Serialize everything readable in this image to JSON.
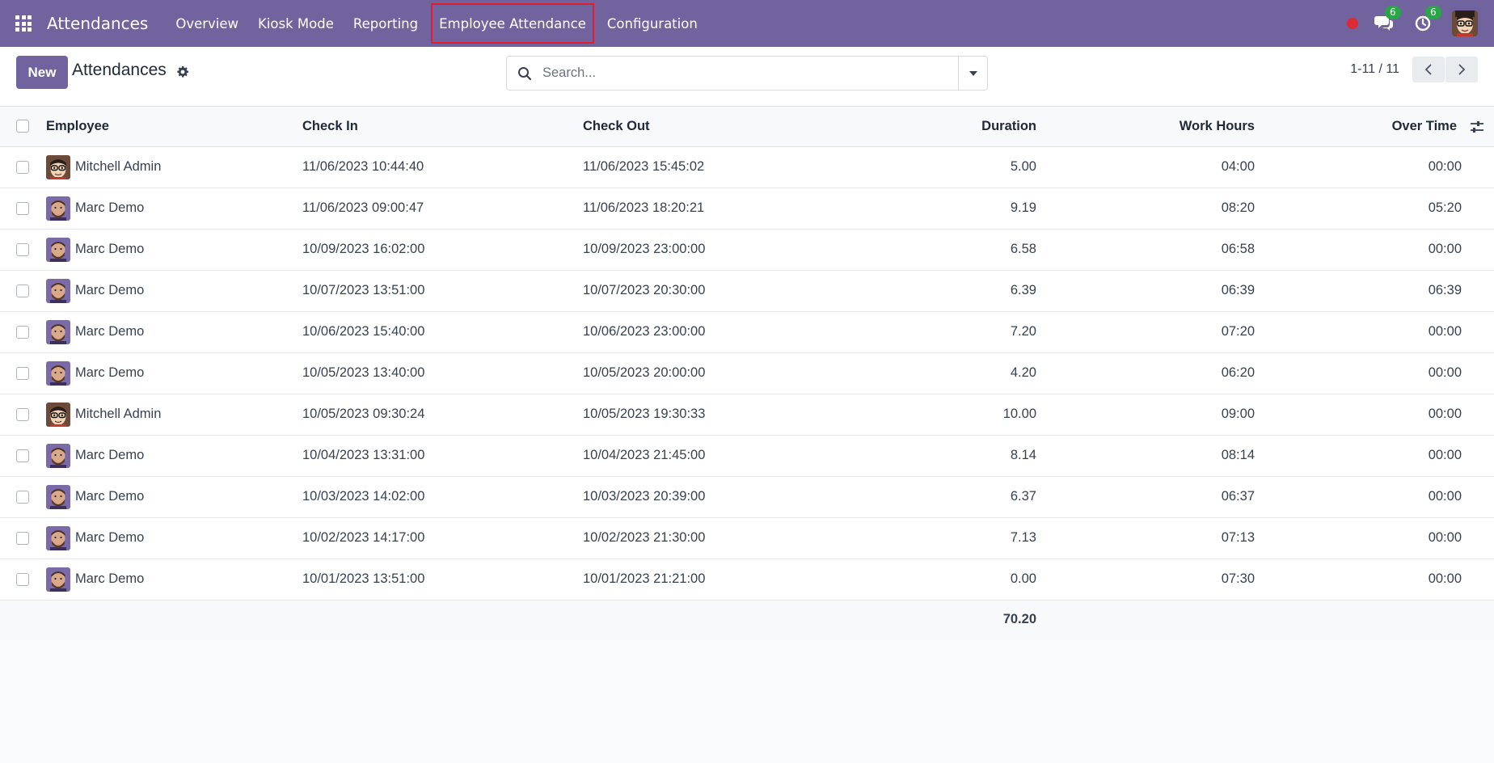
{
  "navbar": {
    "app_name": "Attendances",
    "menu": [
      "Overview",
      "Kiosk Mode",
      "Reporting",
      "Employee Attendance",
      "Configuration"
    ],
    "messages_count": "6",
    "activities_count": "6",
    "accent": "#71639e",
    "highlight_color": "#e11d2e"
  },
  "control": {
    "new_label": "New",
    "title": "Attendances",
    "search_placeholder": "Search...",
    "pager": "1-11 / 11"
  },
  "table": {
    "headers": {
      "employee": "Employee",
      "check_in": "Check In",
      "check_out": "Check Out",
      "duration": "Duration",
      "work_hours": "Work Hours",
      "over_time": "Over Time"
    },
    "rows": [
      {
        "employee": "Mitchell Admin",
        "avatar": "mitchell",
        "check_in": "11/06/2023 10:44:40",
        "check_out": "11/06/2023 15:45:02",
        "duration": "5.00",
        "work_hours": "04:00",
        "over_time": "00:00"
      },
      {
        "employee": "Marc Demo",
        "avatar": "marc",
        "check_in": "11/06/2023 09:00:47",
        "check_out": "11/06/2023 18:20:21",
        "duration": "9.19",
        "work_hours": "08:20",
        "over_time": "05:20"
      },
      {
        "employee": "Marc Demo",
        "avatar": "marc",
        "check_in": "10/09/2023 16:02:00",
        "check_out": "10/09/2023 23:00:00",
        "duration": "6.58",
        "work_hours": "06:58",
        "over_time": "00:00"
      },
      {
        "employee": "Marc Demo",
        "avatar": "marc",
        "check_in": "10/07/2023 13:51:00",
        "check_out": "10/07/2023 20:30:00",
        "duration": "6.39",
        "work_hours": "06:39",
        "over_time": "06:39"
      },
      {
        "employee": "Marc Demo",
        "avatar": "marc",
        "check_in": "10/06/2023 15:40:00",
        "check_out": "10/06/2023 23:00:00",
        "duration": "7.20",
        "work_hours": "07:20",
        "over_time": "00:00"
      },
      {
        "employee": "Marc Demo",
        "avatar": "marc",
        "check_in": "10/05/2023 13:40:00",
        "check_out": "10/05/2023 20:00:00",
        "duration": "4.20",
        "work_hours": "06:20",
        "over_time": "00:00"
      },
      {
        "employee": "Mitchell Admin",
        "avatar": "mitchell",
        "check_in": "10/05/2023 09:30:24",
        "check_out": "10/05/2023 19:30:33",
        "duration": "10.00",
        "work_hours": "09:00",
        "over_time": "00:00"
      },
      {
        "employee": "Marc Demo",
        "avatar": "marc",
        "check_in": "10/04/2023 13:31:00",
        "check_out": "10/04/2023 21:45:00",
        "duration": "8.14",
        "work_hours": "08:14",
        "over_time": "00:00"
      },
      {
        "employee": "Marc Demo",
        "avatar": "marc",
        "check_in": "10/03/2023 14:02:00",
        "check_out": "10/03/2023 20:39:00",
        "duration": "6.37",
        "work_hours": "06:37",
        "over_time": "00:00"
      },
      {
        "employee": "Marc Demo",
        "avatar": "marc",
        "check_in": "10/02/2023 14:17:00",
        "check_out": "10/02/2023 21:30:00",
        "duration": "7.13",
        "work_hours": "07:13",
        "over_time": "00:00"
      },
      {
        "employee": "Marc Demo",
        "avatar": "marc",
        "check_in": "10/01/2023 13:51:00",
        "check_out": "10/01/2023 21:21:00",
        "duration": "0.00",
        "work_hours": "07:30",
        "over_time": "00:00"
      }
    ],
    "total_duration": "70.20"
  }
}
